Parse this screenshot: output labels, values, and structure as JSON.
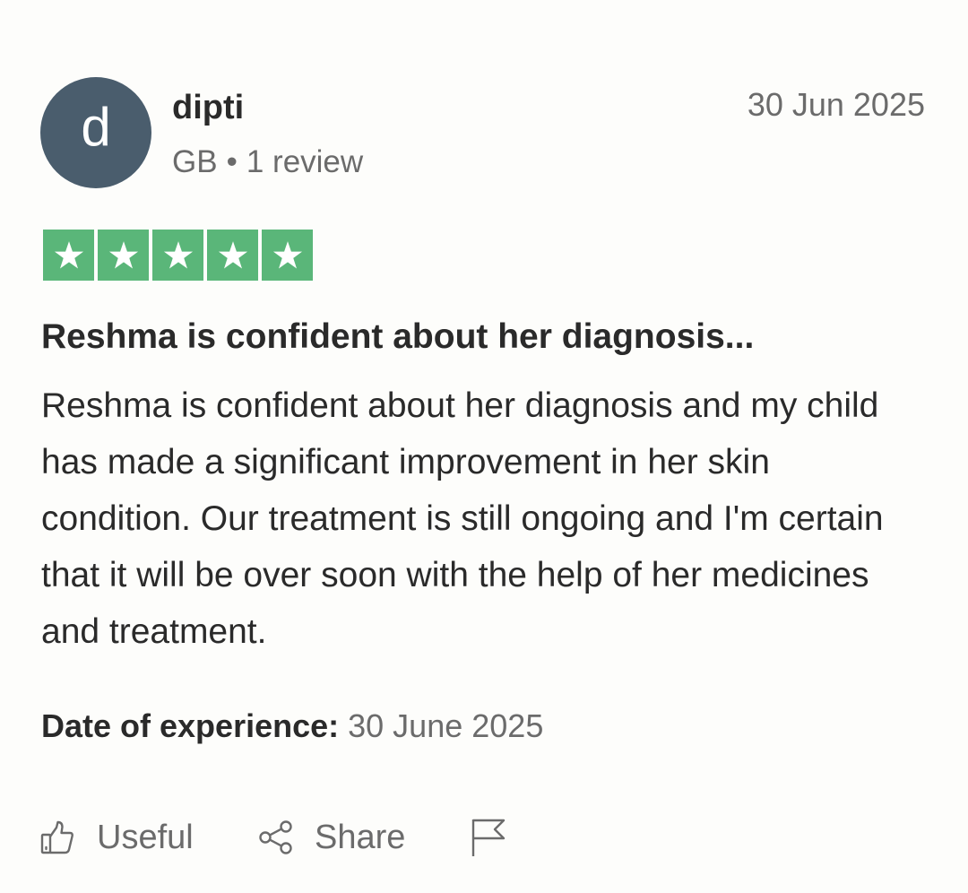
{
  "reviewer": {
    "avatar_letter": "d",
    "name": "dipti",
    "country": "GB",
    "separator": "•",
    "review_count": "1 review"
  },
  "review": {
    "date": "30 Jun 2025",
    "rating": 5,
    "rating_max": 5,
    "title": "Reshma is confident about her diagnosis...",
    "body": "Reshma is confident about her diagnosis and my child has made a significant improvement in her skin condition. Our treatment is still ongoing and I'm certain that it will be over soon with the help of her medicines and treatment.",
    "experience_label": "Date of experience:",
    "experience_date": "30 June 2025"
  },
  "actions": {
    "useful_label": "Useful",
    "share_label": "Share",
    "useful_icon": "thumbs-up-icon",
    "share_icon": "share-icon",
    "flag_icon": "flag-icon"
  },
  "colors": {
    "star_green": "#5ab679",
    "avatar_bg": "#4a5d6d",
    "muted_text": "#6b6b6b"
  }
}
